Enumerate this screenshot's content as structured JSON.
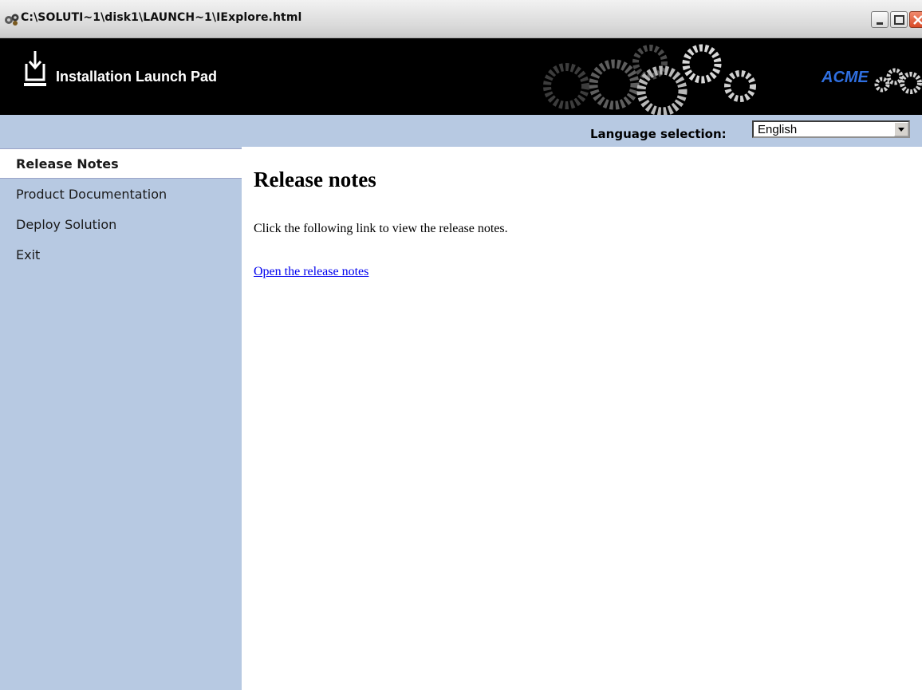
{
  "window": {
    "title": "C:\\SOLUTI~1\\disk1\\LAUNCH~1\\IExplore.html",
    "icon": "app-gears-icon",
    "buttons": [
      "minimize-icon",
      "maximize-icon",
      "close-icon"
    ]
  },
  "banner": {
    "app_name": "Installation Launch Pad",
    "brand": "ACME",
    "brand_color": "#2f6fe0",
    "background": "#000000"
  },
  "language": {
    "label": "Language selection:",
    "selected": "English"
  },
  "sidebar": {
    "background": "#b7c9e2",
    "items": [
      {
        "label": "Release Notes",
        "active": true
      },
      {
        "label": "Product Documentation",
        "active": false
      },
      {
        "label": "Deploy Solution",
        "active": false
      },
      {
        "label": "Exit",
        "active": false
      }
    ]
  },
  "main": {
    "heading": "Release notes",
    "intro": "Click the following link to view the release notes.",
    "link": "Open the release notes",
    "link_color": "#0000ee"
  }
}
